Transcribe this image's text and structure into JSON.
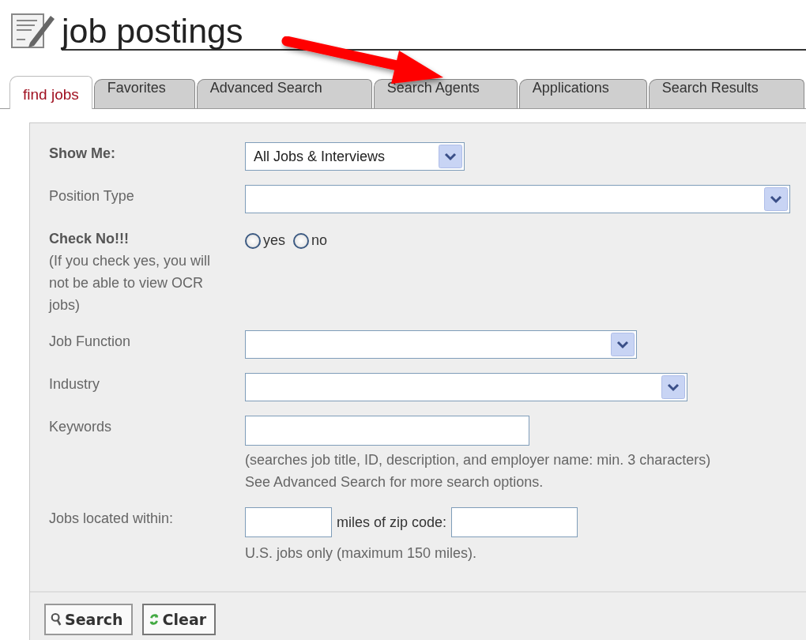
{
  "header": {
    "title": "job postings"
  },
  "tabs": [
    {
      "label": "find jobs",
      "selected": true
    },
    {
      "label": "Favorites",
      "selected": false
    },
    {
      "label": "Advanced Search",
      "selected": false
    },
    {
      "label": "Search Agents",
      "selected": false
    },
    {
      "label": "Applications",
      "selected": false
    },
    {
      "label": "Search Results",
      "selected": false
    }
  ],
  "form": {
    "fields": [
      {
        "kind": "select",
        "label": "Show Me:",
        "bold": true,
        "value": "All Jobs & Interviews"
      },
      {
        "kind": "select",
        "label": "Position Type",
        "bold": false
      },
      {
        "kind": "radio",
        "label": "Check No!!!",
        "bold": true,
        "note": "(If you check yes, you will not be able to view OCR jobs)",
        "options": [
          {
            "label": "yes",
            "selected": false
          },
          {
            "label": "no",
            "selected": false
          }
        ]
      },
      {
        "kind": "select",
        "label": "Job Function",
        "bold": false
      },
      {
        "kind": "select",
        "label": "Industry",
        "bold": false
      },
      {
        "kind": "text",
        "label": "Keywords",
        "bold": false,
        "hints": [
          "(searches job title, ID, description, and employer name: min. 3 characters)",
          "See Advanced Search for more search options."
        ]
      },
      {
        "kind": "location",
        "label": "Jobs located within:",
        "bold": false,
        "middle": "miles of zip code:",
        "hints": [
          "U.S. jobs only (maximum 150 miles)."
        ]
      }
    ],
    "buttons": [
      {
        "kind": "search",
        "label": "Search"
      },
      {
        "kind": "clear",
        "label": "Clear"
      }
    ]
  }
}
